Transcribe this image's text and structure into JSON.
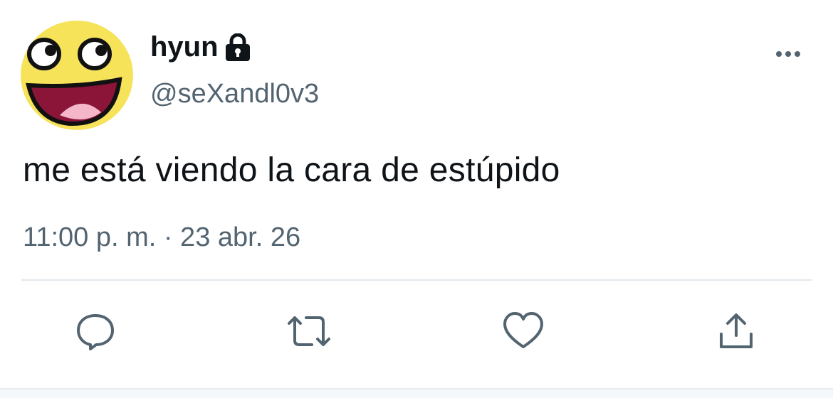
{
  "tweet": {
    "display_name": "hyun",
    "handle": "@seXandl0v3",
    "text": "me está viendo la cara de estúpido",
    "timestamp": "11:00 p. m. · 23 abr. 26"
  },
  "icons": {
    "avatar": "awesome-face-avatar",
    "lock": "lock-icon",
    "more": "more-options-icon",
    "reply": "reply-icon",
    "retweet": "retweet-icon",
    "like": "heart-icon",
    "share": "share-icon"
  },
  "colors": {
    "primary_text": "#0f1419",
    "secondary_text": "#536471",
    "divider": "#e1e8ed",
    "avatar_yellow": "#f6e35a",
    "avatar_mouth": "#8a1538",
    "avatar_tongue": "#f4b6c8"
  }
}
